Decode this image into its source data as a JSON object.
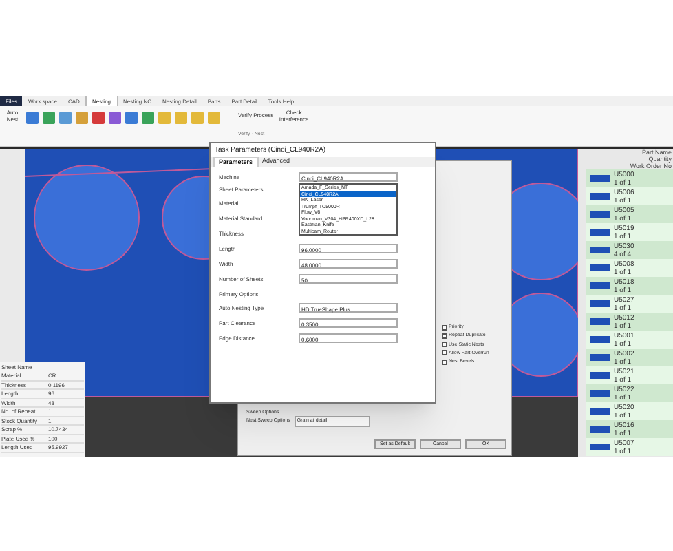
{
  "ribbon_tabs": [
    {
      "label": "Files",
      "selected": false,
      "kind": "file"
    },
    {
      "label": "Work space",
      "selected": false,
      "kind": "tab"
    },
    {
      "label": "CAD",
      "selected": false,
      "kind": "tab"
    },
    {
      "label": "Nesting",
      "selected": true,
      "kind": "tab"
    },
    {
      "label": "Nesting NC",
      "selected": false,
      "kind": "tab"
    },
    {
      "label": "Nesting Detail",
      "selected": false,
      "kind": "tab"
    },
    {
      "label": "Parts",
      "selected": false,
      "kind": "tab"
    },
    {
      "label": "Part Detail",
      "selected": false,
      "kind": "tab"
    },
    {
      "label": "Tools Help",
      "selected": false,
      "kind": "tab"
    }
  ],
  "toolbar": {
    "left_label": "Auto Nest",
    "verify_button": "Verify Process",
    "check_button": "Check Interference",
    "group_label": "Verify - Nest"
  },
  "sheet_properties": {
    "header": "Sheet Name",
    "rows": [
      {
        "label": "Material",
        "value": "CR"
      },
      {
        "label": "Thickness",
        "value": "0.1196"
      },
      {
        "label": "Length",
        "value": "96"
      },
      {
        "label": "Width",
        "value": "48"
      },
      {
        "label": "No. of Repeat",
        "value": "1"
      },
      {
        "label": "Stock Quantity",
        "value": "1"
      },
      {
        "label": "Scrap %",
        "value": "10.7434"
      },
      {
        "label": "Plate Used %",
        "value": "100"
      },
      {
        "label": "Length Used",
        "value": "95.9927"
      }
    ]
  },
  "parts_list": {
    "columns": [
      "Part Name",
      "Quantity",
      "Work Order No"
    ],
    "rows": [
      {
        "name": "U5000",
        "quantity": "1 of 1"
      },
      {
        "name": "U5006",
        "quantity": "1 of 1"
      },
      {
        "name": "U5005",
        "quantity": "1 of 1"
      },
      {
        "name": "U5019",
        "quantity": "1 of 1"
      },
      {
        "name": "U5030",
        "quantity": "4 of 4"
      },
      {
        "name": "U5008",
        "quantity": "1 of 1"
      },
      {
        "name": "U5018",
        "quantity": "1 of 1"
      },
      {
        "name": "U5027",
        "quantity": "1 of 1"
      },
      {
        "name": "U5012",
        "quantity": "1 of 1"
      },
      {
        "name": "U5001",
        "quantity": "1 of 1"
      },
      {
        "name": "U5002",
        "quantity": "1 of 1"
      },
      {
        "name": "U5021",
        "quantity": "1 of 1"
      },
      {
        "name": "U5022",
        "quantity": "1 of 1"
      },
      {
        "name": "U5020",
        "quantity": "1 of 1"
      },
      {
        "name": "U5016",
        "quantity": "1 of 1"
      },
      {
        "name": "U5007",
        "quantity": "1 of 1"
      }
    ]
  },
  "back_dialog": {
    "checkboxes": [
      {
        "label": "Priority",
        "checked": false
      },
      {
        "label": "Repeat Duplicate",
        "checked": false
      },
      {
        "label": "Use Static Nests",
        "checked": false
      },
      {
        "label": "Allow Part Overrun",
        "checked": false
      },
      {
        "label": "Nest Bevels",
        "checked": false
      }
    ],
    "sweep_group": "Sweep Options",
    "sweep_label": "Nest Sweep Options",
    "sweep_value": "Grain at detail",
    "buttons": [
      "Set as Default",
      "Cancel",
      "OK"
    ]
  },
  "task_dialog": {
    "title": "Task Parameters (Cinci_CL940R2A)",
    "tabs": [
      {
        "label": "Parameters",
        "selected": true
      },
      {
        "label": "Advanced",
        "selected": false
      }
    ],
    "machine_label": "Machine",
    "machine_value": "Cinci_CL940R2A",
    "machine_options": [
      {
        "label": "Amada_F_Series_NT",
        "selected": false
      },
      {
        "label": "Cinci_CL940R2A",
        "selected": true
      },
      {
        "label": "HK_Laser",
        "selected": false
      },
      {
        "label": "Trumpf_TC5000R",
        "selected": false
      },
      {
        "label": "Flow_V6",
        "selected": false
      },
      {
        "label": "Voortman_V304_HPR400XD_L28",
        "selected": false
      },
      {
        "label": "Eastman_Knife",
        "selected": false
      },
      {
        "label": "Multicam_Router",
        "selected": false
      }
    ],
    "sheet_group": "Sheet Parameters",
    "sheet_fields": [
      {
        "label": "Material"
      },
      {
        "label": "Material Standard"
      },
      {
        "label": "Thickness"
      },
      {
        "label": "Length",
        "value": "96.0000"
      },
      {
        "label": "Width",
        "value": "48.0000"
      },
      {
        "label": "Number of Sheets",
        "value": "50"
      }
    ],
    "primary_group": "Primary Options",
    "auto_label": "Auto Nesting Type",
    "auto_value": "HD TrueShape Plus",
    "primary_fields": [
      {
        "label": "Part Clearance",
        "value": "0.3500"
      },
      {
        "label": "Edge Distance",
        "value": "0.6000"
      }
    ]
  }
}
